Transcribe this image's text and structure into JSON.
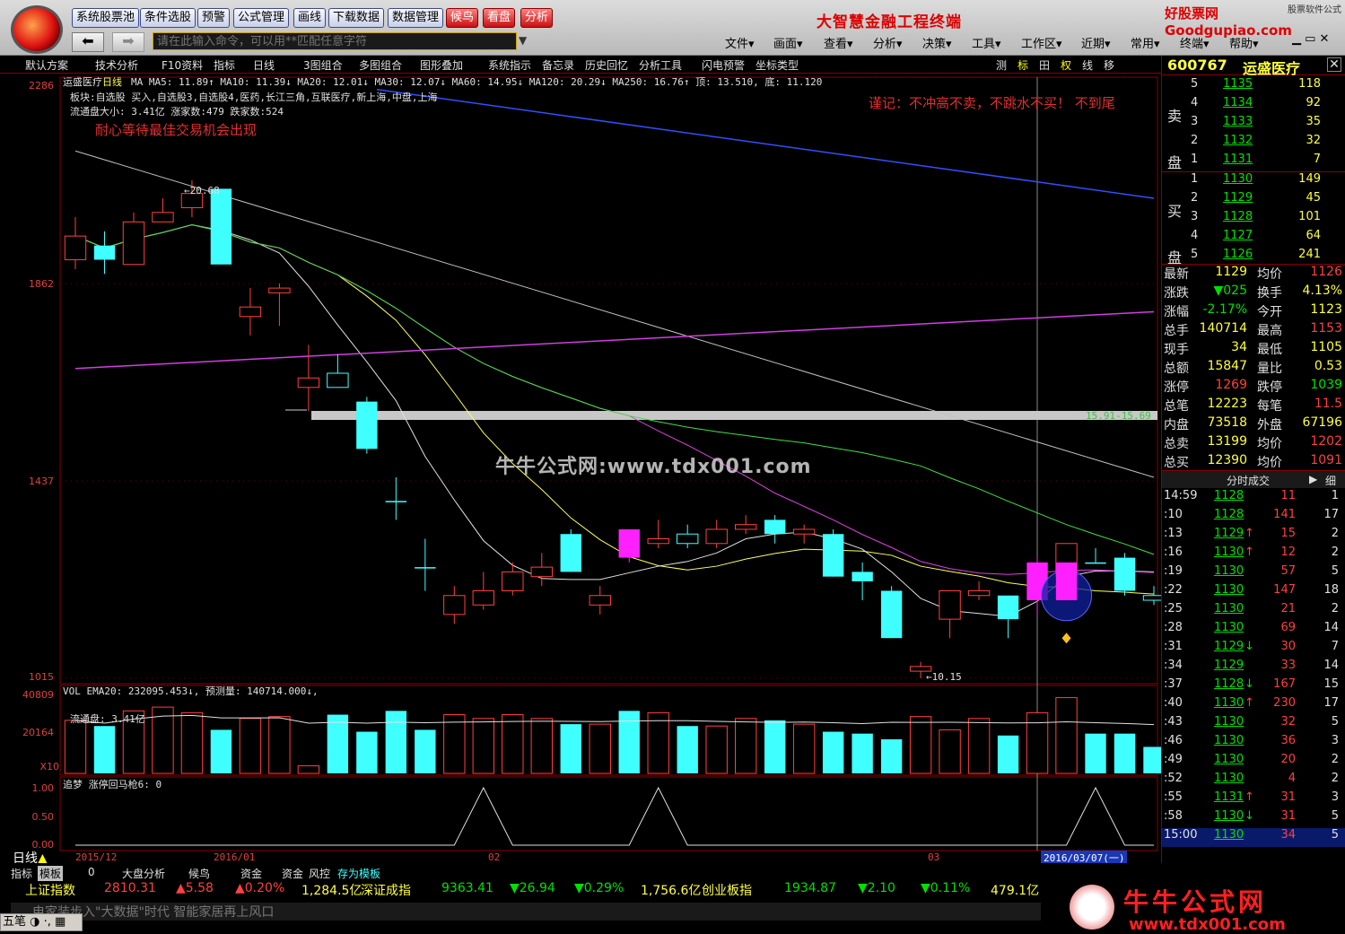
{
  "toolbar_top": {
    "buttons": [
      "系统股票池",
      "条件选股",
      "预警",
      "公式管理",
      "画线",
      "下载数据",
      "数据管理",
      "候鸟",
      "看盘",
      "分析"
    ],
    "brand": "大智慧金融工程终端",
    "site_logo": "好股票网Goodgupiao.com",
    "site_logo_sub": "股票软件公式",
    "command_placeholder": "请在此输入命令，可以用**匹配任意字符",
    "menus": [
      "文件▾",
      "画面▾",
      "查看▾",
      "分析▾",
      "决策▾",
      "工具▾",
      "工作区▾",
      "近期▾",
      "常用▾",
      "终端▾",
      "帮助▾"
    ]
  },
  "toolbar2": {
    "items": [
      "默认方案",
      "技术分析",
      "F10资料",
      "指标",
      "日线",
      "3图组合",
      "多图组合",
      "图形叠加",
      "系统指示",
      "备忘录",
      "历史回忆",
      "分析工具",
      "闪电预警",
      "坐标类型"
    ],
    "right": [
      "测",
      "标",
      "田",
      "权",
      "线",
      "移"
    ]
  },
  "chart": {
    "stock_name": "运盛医疗",
    "period": "日线",
    "ma_line": "MA MA5: 11.89↑ MA10: 11.39↓ MA20: 12.01↓ MA30: 12.07↓ MA60: 14.95↓ MA120: 20.29↓ MA250: 16.76↑ 顶: 13.510, 底: 11.120",
    "sector_line": "板块:自选股 买入,自选股3,自选股4,医药,长江三角,互联医疗,新上海,中盘,上海",
    "float_line": "流通盘大小: 3.41亿 涨家数:479 跌家数:524",
    "note1": "耐心等待最佳交易机会出现",
    "note2": "谨记：不冲高不卖，不跳水不买！ 不到尾",
    "y_labels": [
      "2286",
      "1862",
      "1437",
      "1015"
    ],
    "band_label": "15.91-15.69",
    "high_label": "20.68",
    "low_label": "10.15",
    "x_labels": [
      "2015/12",
      "2016/01",
      "02",
      "03"
    ],
    "date_cursor": "2016/03/07(一)",
    "vol_title": "VOL EMA20: 232095.453↓, 预测量: 140714.000↓,",
    "vol_float": "流通盘: 3.41亿",
    "vol_y": [
      "40809",
      "20164",
      "X10"
    ],
    "ind_title": "追梦 涨停回马枪6: 0",
    "ind_y": [
      "1.00",
      "0.50",
      "0.00"
    ],
    "period_tab": "日线"
  },
  "chart_data": {
    "type": "candlestick",
    "candles": [
      [
        19.0,
        19.9,
        18.8,
        19.5,
        0
      ],
      [
        19.3,
        19.6,
        18.7,
        19.0,
        1
      ],
      [
        18.9,
        20.0,
        18.9,
        19.8,
        0
      ],
      [
        19.8,
        20.3,
        19.8,
        20.0,
        0
      ],
      [
        20.1,
        20.68,
        19.9,
        20.4,
        0
      ],
      [
        20.5,
        20.5,
        18.9,
        18.9,
        1
      ],
      [
        17.8,
        18.4,
        17.4,
        18.0,
        0
      ],
      [
        18.3,
        18.5,
        17.6,
        18.4,
        0
      ],
      [
        16.3,
        17.2,
        15.8,
        16.5,
        0
      ],
      [
        16.6,
        17.0,
        16.4,
        16.3,
        0
      ],
      [
        16.0,
        16.1,
        14.9,
        15.0,
        1
      ],
      [
        13.9,
        14.4,
        13.5,
        13.9,
        1
      ],
      [
        12.5,
        13.1,
        12.0,
        12.5,
        1
      ],
      [
        11.5,
        12.1,
        11.3,
        11.9,
        0
      ],
      [
        11.7,
        12.4,
        11.6,
        12.0,
        0
      ],
      [
        12.0,
        12.6,
        11.9,
        12.4,
        0
      ],
      [
        12.3,
        12.8,
        12.1,
        12.5,
        0
      ],
      [
        13.2,
        13.3,
        12.4,
        12.4,
        1
      ],
      [
        11.7,
        12.1,
        11.5,
        11.9,
        0
      ],
      [
        13.3,
        13.3,
        12.6,
        12.7,
        2
      ],
      [
        13.0,
        13.5,
        12.9,
        13.1,
        0
      ],
      [
        13.2,
        13.4,
        12.9,
        13.0,
        0
      ],
      [
        13.0,
        13.5,
        12.9,
        13.3,
        0
      ],
      [
        13.3,
        13.6,
        13.2,
        13.4,
        0
      ],
      [
        13.5,
        13.6,
        13.0,
        13.2,
        1
      ],
      [
        13.2,
        13.4,
        13.0,
        13.3,
        0
      ],
      [
        13.2,
        13.3,
        12.3,
        12.3,
        1
      ],
      [
        12.4,
        12.6,
        11.8,
        12.2,
        1
      ],
      [
        12.0,
        12.1,
        11.0,
        11.0,
        1
      ],
      [
        10.3,
        10.5,
        10.15,
        10.4,
        0
      ],
      [
        11.4,
        12.0,
        11.0,
        12.0,
        0
      ],
      [
        11.9,
        12.2,
        11.8,
        12.0,
        0
      ],
      [
        11.4,
        11.8,
        11.0,
        11.9,
        1
      ],
      [
        11.8,
        12.7,
        11.5,
        12.6,
        2
      ],
      [
        12.3,
        13.0,
        12.1,
        13.0,
        0
      ],
      [
        12.6,
        12.9,
        12.6,
        12.6,
        1
      ],
      [
        12.7,
        12.8,
        11.9,
        12.0,
        1
      ],
      [
        11.9,
        12.1,
        11.7,
        11.8,
        0
      ]
    ],
    "x_labels": [
      "2015/12",
      "2016/01",
      "02",
      "03"
    ],
    "y_labels": [
      "22.86",
      "18.62",
      "14.37",
      "10.15"
    ],
    "volumes": [
      28,
      25,
      33,
      35,
      32,
      23,
      29,
      30,
      4,
      31,
      22,
      33,
      23,
      31,
      29,
      31,
      29,
      26,
      26,
      33,
      32,
      25,
      25,
      29,
      28,
      26,
      22,
      21,
      18,
      30,
      23,
      29,
      20,
      32,
      40,
      21,
      21,
      14
    ]
  },
  "orderbook": {
    "code": "600767",
    "name": "运盛医疗",
    "sell": [
      [
        "5",
        "1135",
        "118"
      ],
      [
        "4",
        "1134",
        "92"
      ],
      [
        "3",
        "1133",
        "35"
      ],
      [
        "2",
        "1132",
        "32"
      ],
      [
        "1",
        "1131",
        "7"
      ]
    ],
    "buy": [
      [
        "1",
        "1130",
        "149"
      ],
      [
        "2",
        "1129",
        "45"
      ],
      [
        "3",
        "1128",
        "101"
      ],
      [
        "4",
        "1127",
        "64"
      ],
      [
        "5",
        "1126",
        "241"
      ]
    ],
    "sell_label": "卖盘",
    "buy_label": "买盘",
    "stats": [
      [
        "最新",
        "1129",
        "均价",
        "1126"
      ],
      [
        "涨跌",
        "▼025",
        "换手",
        "4.13%"
      ],
      [
        "涨幅",
        "-2.17%",
        "今开",
        "1123"
      ],
      [
        "总手",
        "140714",
        "最高",
        "1153"
      ],
      [
        "现手",
        "34",
        "最低",
        "1105"
      ],
      [
        "总额",
        "15847",
        "量比",
        "0.53"
      ],
      [
        "涨停",
        "1269",
        "跌停",
        "1039"
      ],
      [
        "总笔",
        "12223",
        "每笔",
        "11.5"
      ],
      [
        "内盘",
        "73518",
        "外盘",
        "67196"
      ],
      [
        "总卖",
        "13199",
        "均价",
        "1202"
      ],
      [
        "总买",
        "12390",
        "均价",
        "1091"
      ]
    ],
    "ticks_title": "分时成交",
    "ticks_btn": "细",
    "ticks": [
      [
        "14:59",
        "1128",
        "11",
        "1",
        ""
      ],
      [
        ":10",
        "1128",
        "141",
        "17",
        ""
      ],
      [
        ":13",
        "1129",
        "15",
        "2",
        "↑"
      ],
      [
        ":16",
        "1130",
        "12",
        "2",
        "↑"
      ],
      [
        ":19",
        "1130",
        "57",
        "5",
        ""
      ],
      [
        ":22",
        "1130",
        "147",
        "18",
        ""
      ],
      [
        ":25",
        "1130",
        "21",
        "2",
        ""
      ],
      [
        ":28",
        "1130",
        "69",
        "14",
        ""
      ],
      [
        ":31",
        "1129",
        "30",
        "7",
        "↓"
      ],
      [
        ":34",
        "1129",
        "33",
        "14",
        ""
      ],
      [
        ":37",
        "1128",
        "167",
        "15",
        "↓"
      ],
      [
        ":40",
        "1130",
        "230",
        "17",
        "↑"
      ],
      [
        ":43",
        "1130",
        "32",
        "5",
        ""
      ],
      [
        ":46",
        "1130",
        "36",
        "3",
        ""
      ],
      [
        ":49",
        "1130",
        "20",
        "2",
        ""
      ],
      [
        ":52",
        "1130",
        "4",
        "2",
        ""
      ],
      [
        ":55",
        "1131",
        "31",
        "3",
        "↑"
      ],
      [
        ":58",
        "1130",
        "31",
        "5",
        "↓"
      ],
      [
        "15:00",
        "1130",
        "34",
        "5",
        ""
      ]
    ]
  },
  "bottom": {
    "tabs": [
      "指标",
      "模板",
      "0",
      "大盘分析",
      "候鸟",
      "资金",
      "资金",
      "风控",
      "存为模板"
    ],
    "indices": [
      "上证指数",
      "2810.31",
      "▲5.58",
      "▲0.20%",
      "1,284.5亿",
      "深证成指",
      "9363.41",
      "▼26.94",
      "▼0.29%",
      "1,756.6亿",
      "创业板指",
      "1934.87",
      "▼2.10",
      "▼0.11%",
      "479.1亿"
    ],
    "news": "电家装步入\"大数据\"时代 智能家居再上风口",
    "logo_top": "牛牛公式网",
    "logo_bottom": "www.tdx001.com",
    "ime": "五笔"
  },
  "watermark": "牛牛公式网:www.tdx001.com"
}
